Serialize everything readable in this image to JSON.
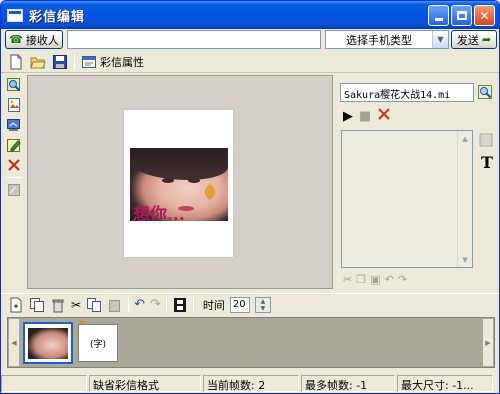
{
  "window": {
    "title": "彩信编辑"
  },
  "recipient": {
    "button_label": "接收人",
    "value": ""
  },
  "phone_type": {
    "selected": "选择手机类型"
  },
  "send": {
    "label": "发送"
  },
  "toolbar": {
    "properties_label": "彩信属性"
  },
  "canvas": {
    "caption": "想你..."
  },
  "sound": {
    "filename": "Sakura樱花大战14.mi"
  },
  "frame_toolbar": {
    "time_label": "时间",
    "time_value": "20"
  },
  "frames": [
    {
      "label": "",
      "has_image": true,
      "has_music": true
    },
    {
      "label": "(字)",
      "has_image": false
    }
  ],
  "statusbar": {
    "default_format": "缺省彩信格式",
    "current_frames": "当前帧数: 2",
    "max_frames": "最多帧数: -1",
    "max_size": "最大尺寸: -1..."
  }
}
